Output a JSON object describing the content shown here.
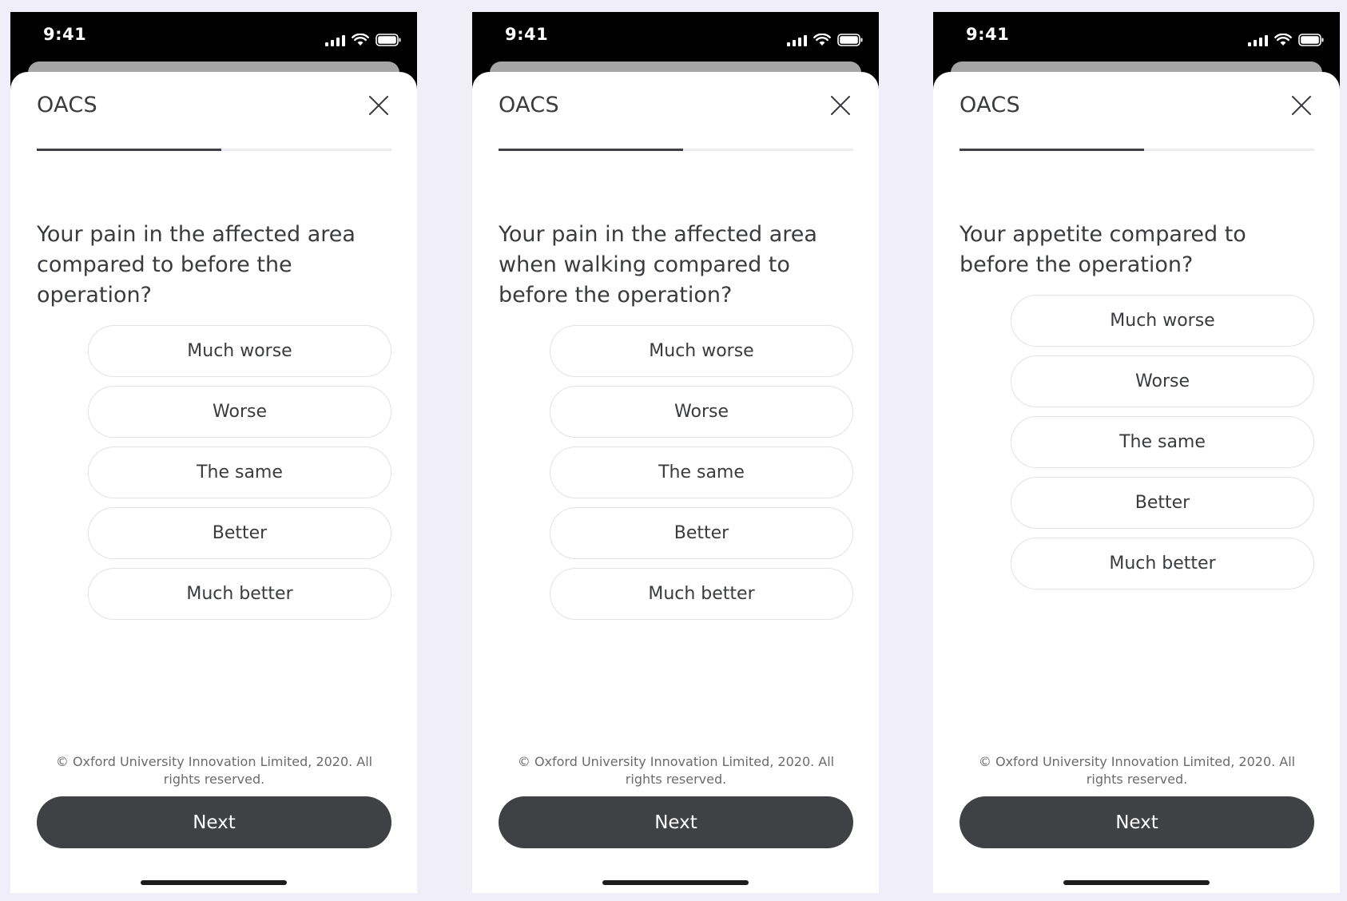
{
  "screens": [
    {
      "status_time": "9:41",
      "title": "OACS",
      "progress": 0.52,
      "question": "Your pain in the affected area compared to before the operation?",
      "options": [
        "Much worse",
        "Worse",
        "The same",
        "Better",
        "Much better"
      ],
      "copyright": "© Oxford University Innovation Limited, 2020. All rights reserved.",
      "next_label": "Next"
    },
    {
      "status_time": "9:41",
      "title": "OACS",
      "progress": 0.52,
      "question": "Your pain in the affected area when walking compared to before the operation?",
      "options": [
        "Much worse",
        "Worse",
        "The same",
        "Better",
        "Much better"
      ],
      "copyright": "© Oxford University Innovation Limited, 2020. All rights reserved.",
      "next_label": "Next"
    },
    {
      "status_time": "9:41",
      "title": "OACS",
      "progress": 0.52,
      "question": "Your appetite compared to before the operation?",
      "options": [
        "Much worse",
        "Worse",
        "The same",
        "Better",
        "Much better"
      ],
      "copyright": "© Oxford University Innovation Limited, 2020. All rights reserved.",
      "next_label": "Next"
    }
  ],
  "icons": {
    "status": [
      "signal-icon",
      "wifi-icon",
      "battery-icon"
    ],
    "close": "close-icon"
  },
  "colors": {
    "background": "#f0eef9",
    "button_dark": "#404145",
    "text": "#3a3b3f",
    "progress": "#3f4045"
  }
}
